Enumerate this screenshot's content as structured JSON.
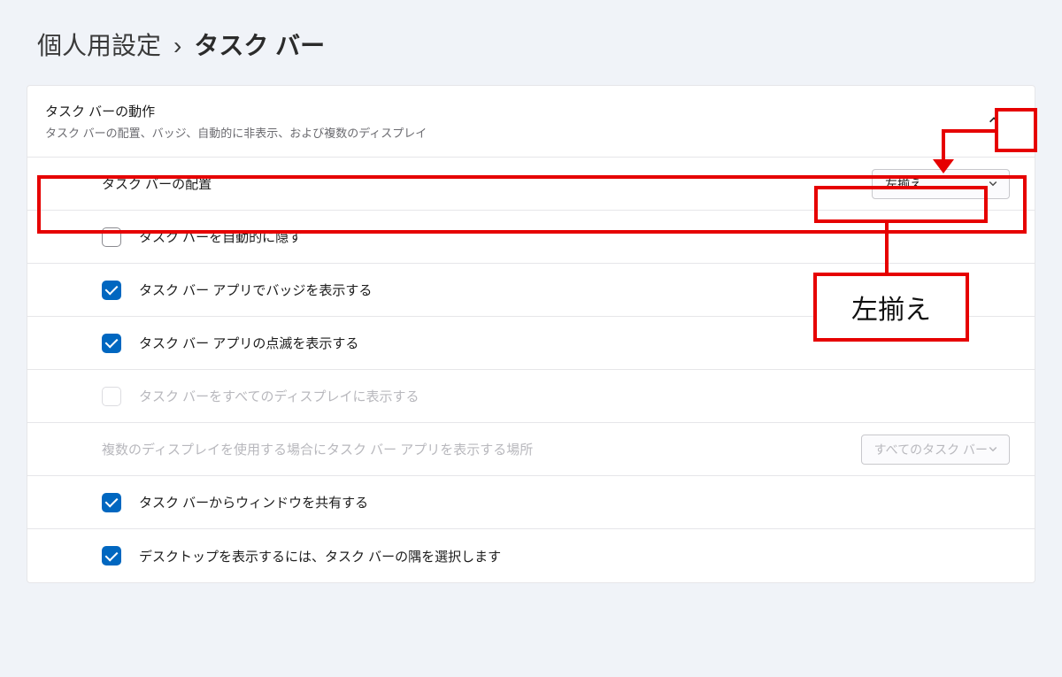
{
  "breadcrumb": {
    "parent": "個人用設定",
    "separator": "›",
    "current": "タスク バー"
  },
  "section": {
    "title": "タスク バーの動作",
    "description": "タスク バーの配置、バッジ、自動的に非表示、および複数のディスプレイ",
    "expanded": true
  },
  "rows": {
    "alignment": {
      "label": "タスク バーの配置",
      "value": "左揃え"
    },
    "auto_hide": {
      "label": "タスク バーを自動的に隠す",
      "checked": false
    },
    "show_badges": {
      "label": "タスク バー アプリでバッジを表示する",
      "checked": true
    },
    "show_flash": {
      "label": "タスク バー アプリの点滅を表示する",
      "checked": true
    },
    "all_displays": {
      "label": "タスク バーをすべてのディスプレイに表示する",
      "checked": false,
      "disabled": true
    },
    "multi_display_where": {
      "label": "複数のディスプレイを使用する場合にタスク バー アプリを表示する場所",
      "value": "すべてのタスク バー",
      "disabled": true
    },
    "share_window": {
      "label": "タスク バーからウィンドウを共有する",
      "checked": true
    },
    "show_desktop": {
      "label": "デスクトップを表示するには、タスク バーの隅を選択します",
      "checked": true
    }
  },
  "callout": {
    "text": "左揃え"
  }
}
